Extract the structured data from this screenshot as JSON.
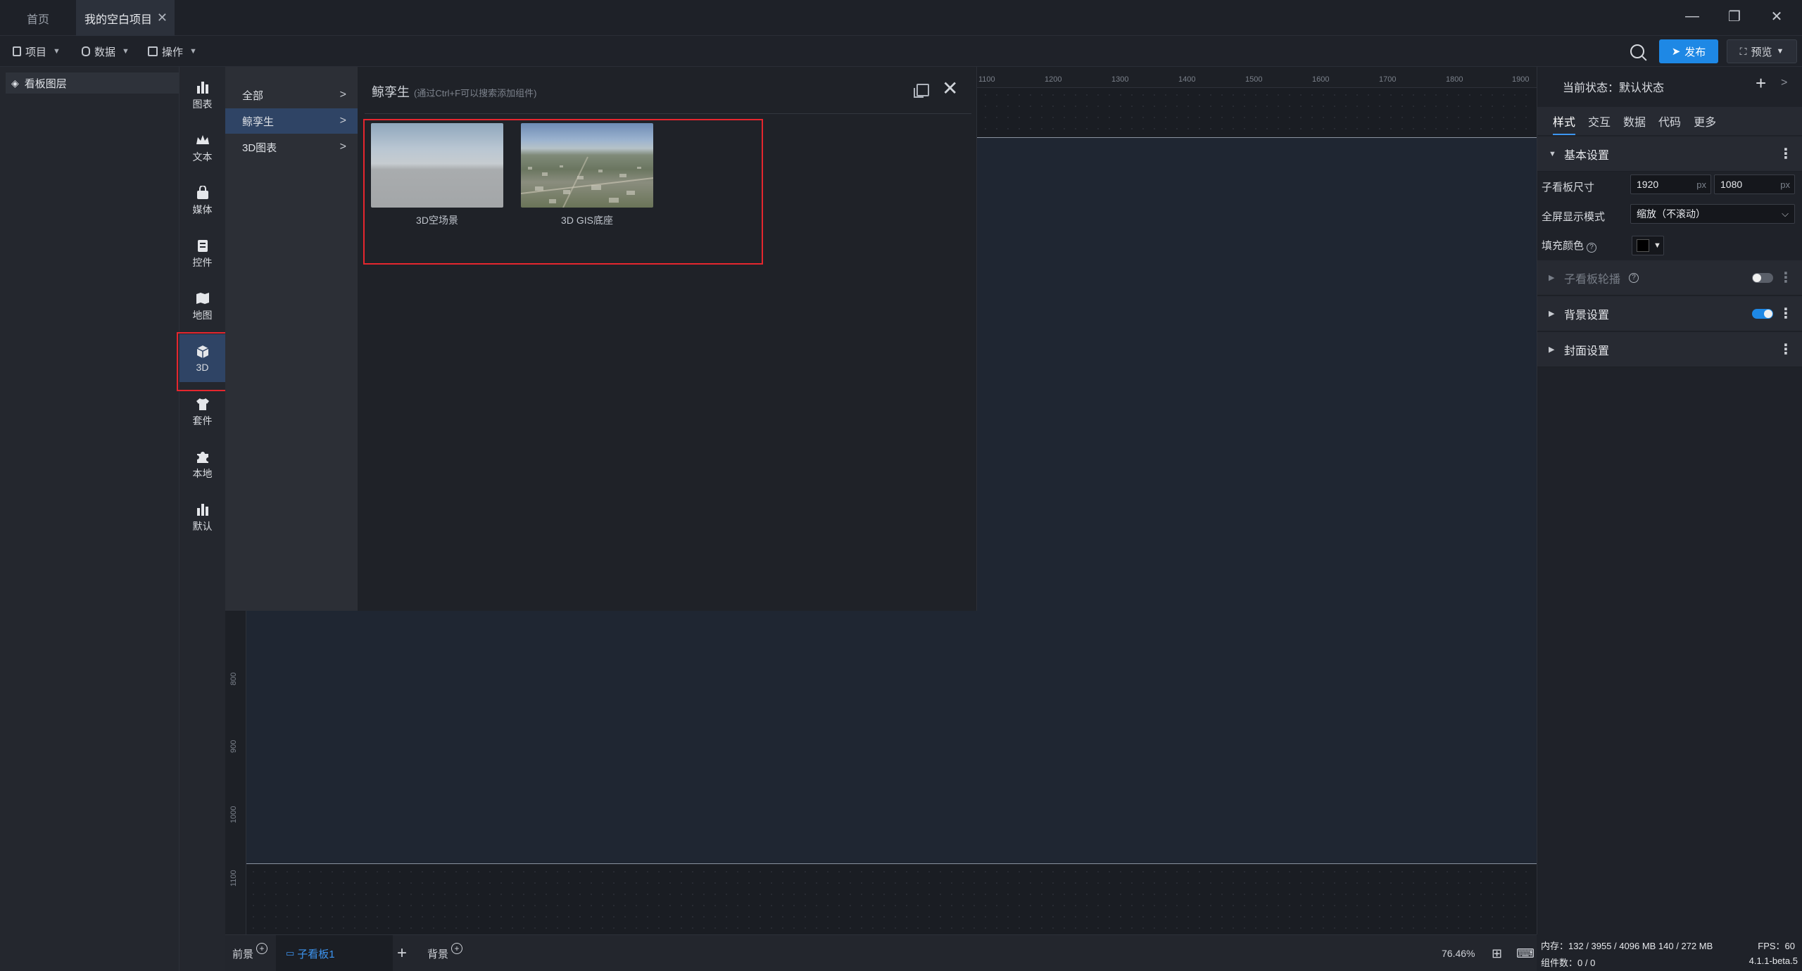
{
  "tabs": {
    "home": "首页",
    "project": "我的空白项目",
    "close": "✕"
  },
  "window_controls": {
    "minimize": "—",
    "restore": "❐",
    "close": "✕"
  },
  "toolbar": {
    "project": "项目",
    "data": "数据",
    "operate": "操作",
    "publish": "发布",
    "preview": "预览"
  },
  "layers": {
    "title": "看板图层"
  },
  "rail": [
    {
      "label": "图表",
      "icon": "bar-chart-icon"
    },
    {
      "label": "文本",
      "icon": "crown-text-icon"
    },
    {
      "label": "媒体",
      "icon": "media-bag-icon"
    },
    {
      "label": "控件",
      "icon": "widget-icon"
    },
    {
      "label": "地图",
      "icon": "map-icon"
    },
    {
      "label": "3D",
      "icon": "cube-icon"
    },
    {
      "label": "套件",
      "icon": "shirt-icon"
    },
    {
      "label": "本地",
      "icon": "puzzle-icon"
    },
    {
      "label": "默认",
      "icon": "bar-chart-icon"
    }
  ],
  "categories": [
    {
      "label": "全部",
      "arrow": ">"
    },
    {
      "label": "鲸孪生",
      "arrow": ">"
    },
    {
      "label": "3D图表",
      "arrow": ">"
    }
  ],
  "popup": {
    "title": "鲸孪生",
    "hint": "(通过Ctrl+F可以搜索添加组件)",
    "close": "✕",
    "items": [
      {
        "label": "3D空场景"
      },
      {
        "label": "3D GIS底座"
      }
    ]
  },
  "ruler": {
    "top": [
      "1100",
      "1200",
      "1300",
      "1400",
      "1500",
      "1600",
      "1700",
      "1800",
      "1900"
    ],
    "left": [
      "800",
      "900",
      "1000",
      "1100"
    ]
  },
  "bottom": {
    "foreground": "前景",
    "sub_board": "子看板1",
    "add": "+",
    "background": "背景",
    "circle_plus": "+",
    "zoom": "76.46%"
  },
  "right_panel": {
    "state": "当前状态：默认状态",
    "add": "+",
    "more_arrow": ">",
    "tabs": [
      "样式",
      "交互",
      "数据",
      "代码",
      "更多"
    ],
    "basic_settings": "基本设置",
    "size_label": "子看板尺寸",
    "width": "1920",
    "height": "1080",
    "unit": "px",
    "fullscreen_label": "全屏显示模式",
    "fullscreen_value": "缩放（不滚动）",
    "fill_label": "填充颜色",
    "help": "?",
    "carousel": "子看板轮播",
    "background_settings": "背景设置",
    "cover_settings": "封面设置",
    "dots": "⋮"
  },
  "status": {
    "memory": "内存：132 / 3955 / 4096 MB 140 / 272 MB",
    "fps": "FPS：60",
    "components": "组件数：0 / 0",
    "version": "4.1.1-beta.5"
  },
  "colors": {
    "accent": "#1e88e5",
    "highlight": "#e5262e",
    "active_bg": "#2f4465"
  }
}
